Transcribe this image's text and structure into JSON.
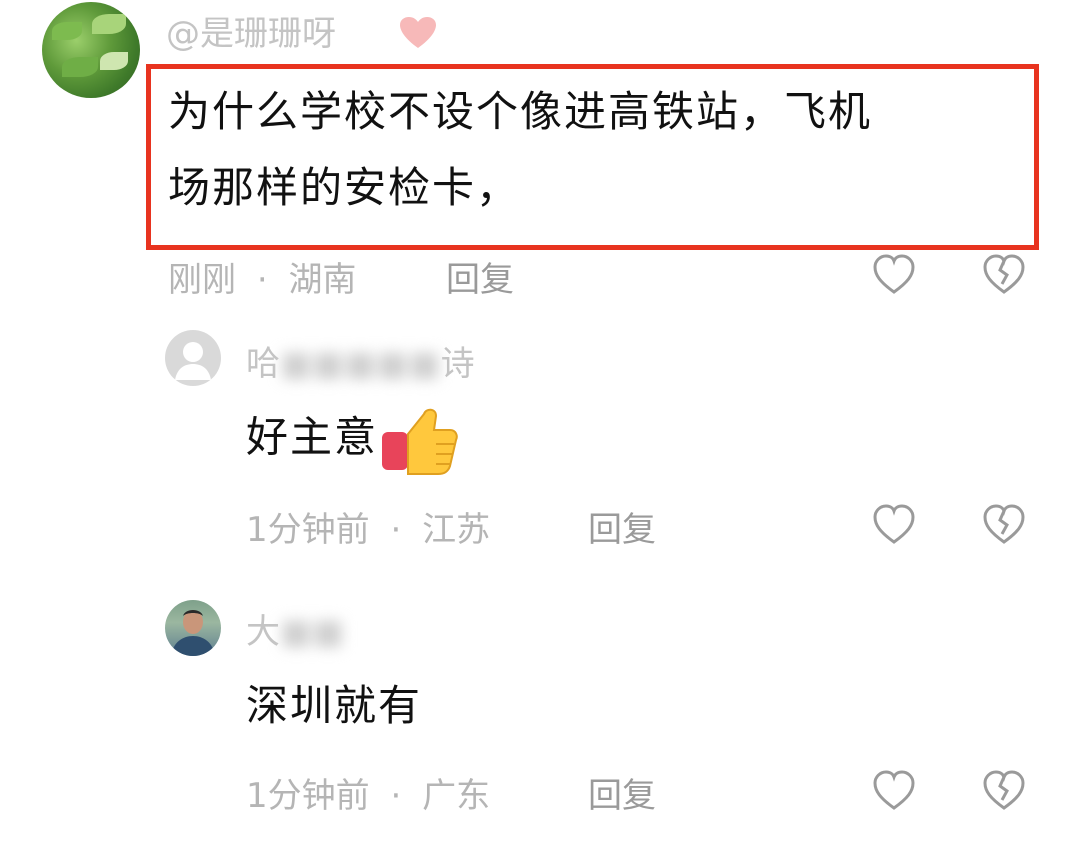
{
  "comments": [
    {
      "username": "@是珊珊呀",
      "text_line1": "为什么学校不设个像进高铁站，飞机",
      "text_line2": "场那样的安检卡，",
      "time": "刚刚",
      "separator": "·",
      "location": "湖南",
      "reply_label": "回复"
    },
    {
      "username_visible": "哈",
      "username_tail": "诗",
      "text": "好主意",
      "emoji": "thumbs-up-icon",
      "time": "1分钟前",
      "separator": "·",
      "location": "江苏",
      "reply_label": "回复"
    },
    {
      "username_visible": "大",
      "text": "深圳就有",
      "time": "1分钟前",
      "separator": "·",
      "location": "广东",
      "reply_label": "回复"
    }
  ],
  "colors": {
    "highlight_border": "#e8331f",
    "meta_text": "#b5b5b5",
    "icon_stroke": "#9a9a9a"
  }
}
